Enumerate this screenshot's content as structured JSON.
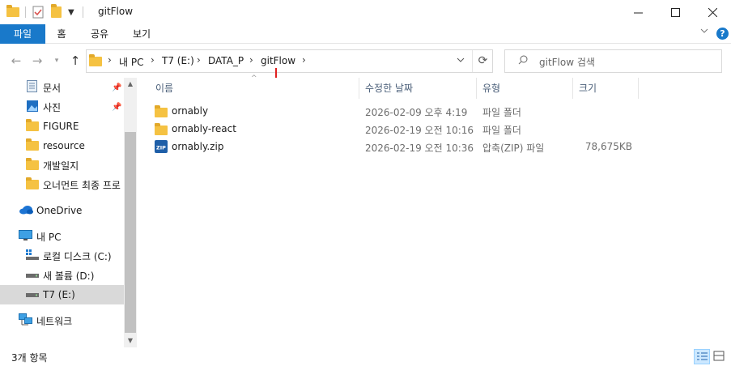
{
  "window": {
    "title": "gitFlow"
  },
  "ribbon": {
    "tabs": [
      {
        "label": "파일",
        "active": true
      },
      {
        "label": "홈",
        "active": false
      },
      {
        "label": "공유",
        "active": false
      },
      {
        "label": "보기",
        "active": false
      }
    ]
  },
  "address": {
    "breadcrumbs": [
      "내 PC",
      "T7 (E:)",
      "DATA_P",
      "gitFlow"
    ]
  },
  "search": {
    "placeholder": "gitFlow 검색"
  },
  "nav": {
    "quick_access": [
      {
        "label": "문서",
        "icon": "documents-icon",
        "pinned": true
      },
      {
        "label": "사진",
        "icon": "pictures-icon",
        "pinned": true
      },
      {
        "label": "FIGURE",
        "icon": "folder-icon",
        "pinned": false
      },
      {
        "label": "resource",
        "icon": "folder-icon",
        "pinned": false
      },
      {
        "label": "개발일지",
        "icon": "folder-icon",
        "pinned": false
      },
      {
        "label": "오너먼트 최종 프로",
        "icon": "folder-icon",
        "pinned": false
      }
    ],
    "onedrive": {
      "label": "OneDrive",
      "icon": "cloud-icon"
    },
    "this_pc": {
      "label": "내 PC",
      "icon": "computer-icon"
    },
    "drives": [
      {
        "label": "로컬 디스크 (C:)",
        "icon": "windows-drive-icon",
        "selected": false
      },
      {
        "label": "새 볼륨 (D:)",
        "icon": "drive-icon",
        "selected": false
      },
      {
        "label": "T7 (E:)",
        "icon": "drive-icon",
        "selected": true
      }
    ],
    "network": {
      "label": "네트워크",
      "icon": "network-icon"
    }
  },
  "columns": {
    "name": "이름",
    "modified": "수정한 날짜",
    "type": "유형",
    "size": "크기"
  },
  "files": [
    {
      "name": "ornably",
      "modified": "2026-02-09 오후 4:19",
      "type": "파일 폴더",
      "size": "",
      "icon": "folder-icon"
    },
    {
      "name": "ornably-react",
      "modified": "2026-02-19 오전 10:16",
      "type": "파일 폴더",
      "size": "",
      "icon": "folder-icon"
    },
    {
      "name": "ornably.zip",
      "modified": "2026-02-19 오전 10:36",
      "type": "압축(ZIP) 파일",
      "size": "78,675KB",
      "icon": "zip-icon"
    }
  ],
  "status": {
    "item_count": "3개 항목"
  },
  "colors": {
    "accent": "#1979ca",
    "folder": "#f5c242",
    "selection": "#d9d9d9",
    "annotation_arrow": "#e02020"
  }
}
